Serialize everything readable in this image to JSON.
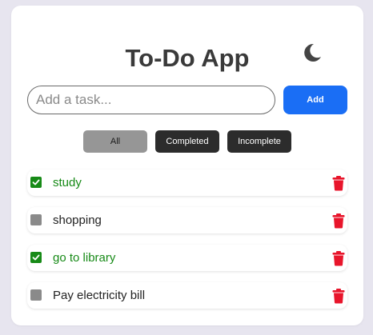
{
  "app": {
    "title": "To-Do App",
    "theme_icon": "moon-icon"
  },
  "input": {
    "placeholder": "Add a task...",
    "value": ""
  },
  "add_button": {
    "label": "Add",
    "color": "#1a6ef5"
  },
  "filters": [
    {
      "label": "All",
      "active": true
    },
    {
      "label": "Completed",
      "active": false
    },
    {
      "label": "Incomplete",
      "active": false
    }
  ],
  "tasks": [
    {
      "text": "study",
      "completed": true
    },
    {
      "text": "shopping",
      "completed": false
    },
    {
      "text": "go to library",
      "completed": true
    },
    {
      "text": "Pay electricity bill",
      "completed": false
    }
  ],
  "colors": {
    "completed_text": "#178a17",
    "delete_icon": "#e8152b",
    "theme_icon": "#444444"
  },
  "icons": {
    "delete": "trash-icon",
    "check": "checkmark-icon"
  }
}
